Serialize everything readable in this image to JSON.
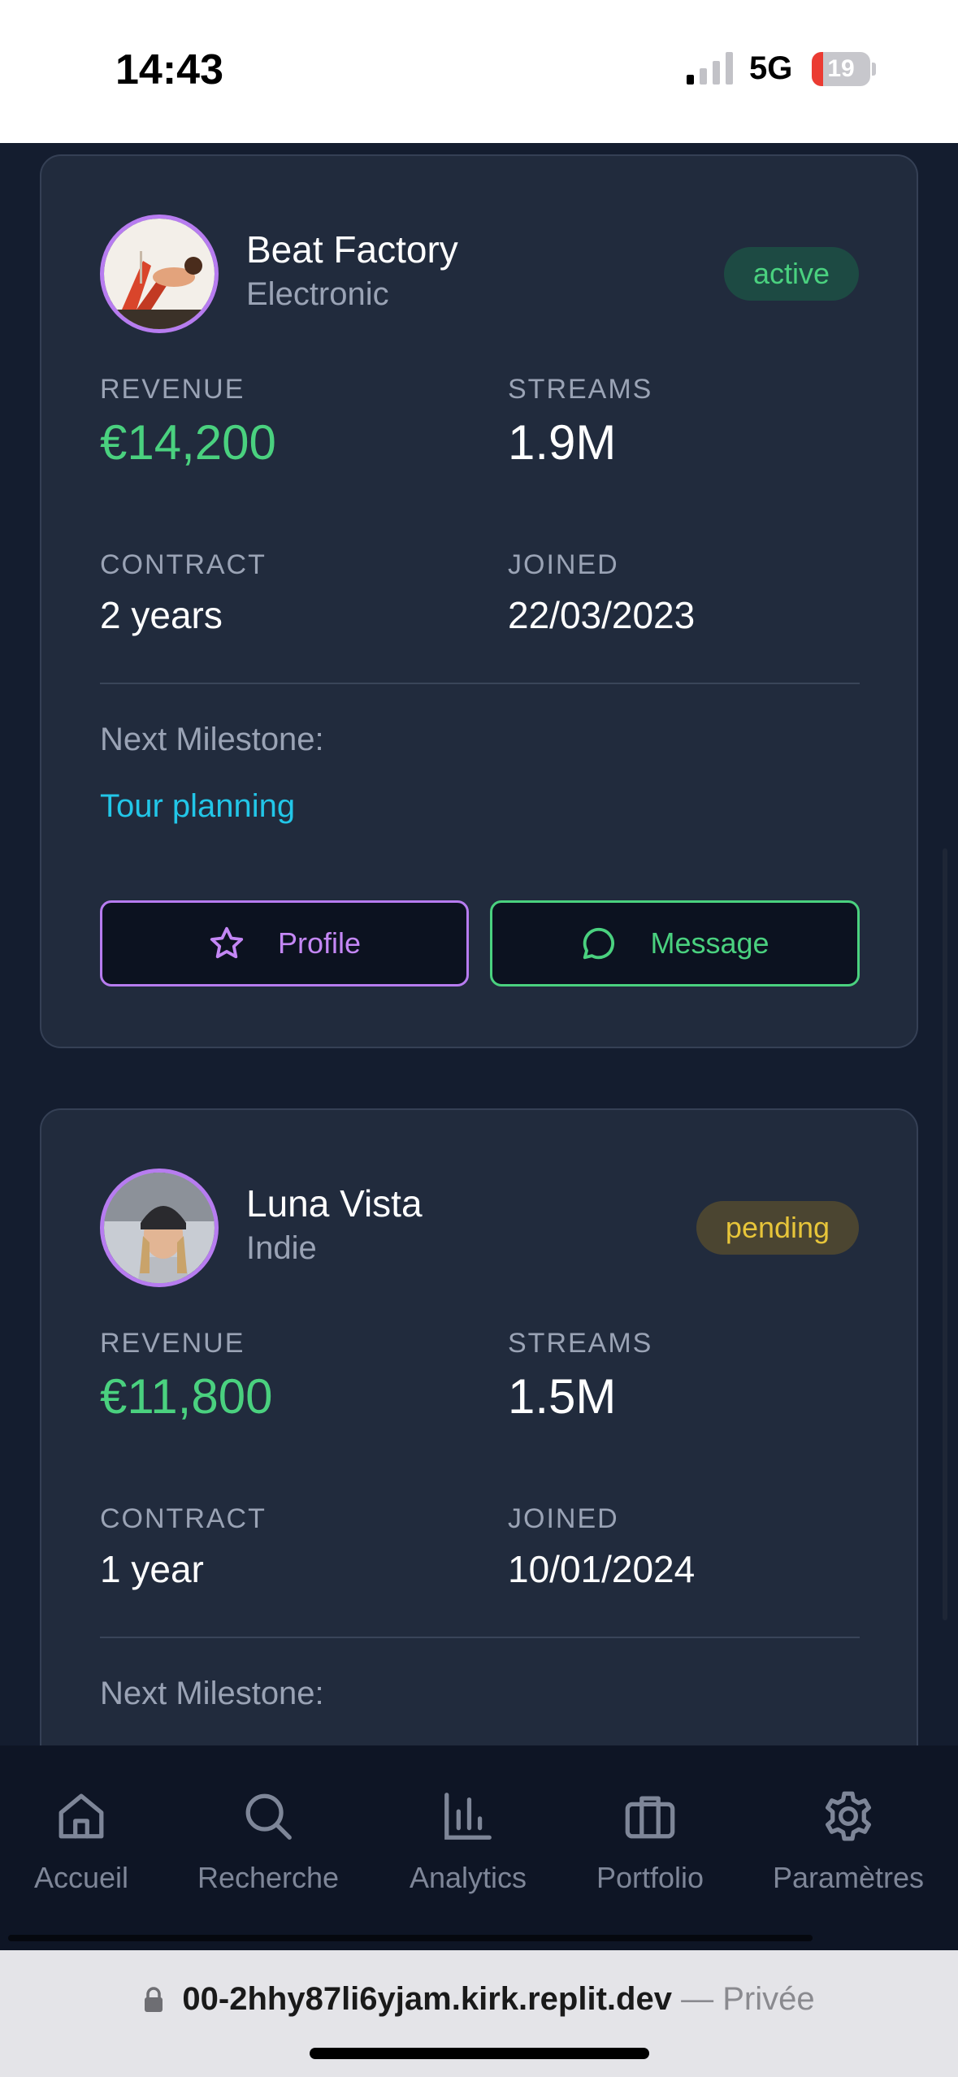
{
  "status_bar": {
    "time": "14:43",
    "network": "5G",
    "battery": "19",
    "battery_level_percent": 19
  },
  "artists": [
    {
      "name": "Beat Factory",
      "genre": "Electronic",
      "status": "active",
      "revenue_label": "REVENUE",
      "revenue": "€14,200",
      "streams_label": "STREAMS",
      "streams": "1.9M",
      "contract_label": "CONTRACT",
      "contract": "2 years",
      "joined_label": "JOINED",
      "joined": "22/03/2023",
      "milestone_label": "Next Milestone:",
      "milestone": "Tour planning",
      "profile_label": "Profile",
      "message_label": "Message"
    },
    {
      "name": "Luna Vista",
      "genre": "Indie",
      "status": "pending",
      "revenue_label": "REVENUE",
      "revenue": "€11,800",
      "streams_label": "STREAMS",
      "streams": "1.5M",
      "contract_label": "CONTRACT",
      "contract": "1 year",
      "joined_label": "JOINED",
      "joined": "10/01/2024",
      "milestone_label": "Next Milestone:"
    }
  ],
  "nav": [
    {
      "label": "Accueil",
      "icon": "home-icon"
    },
    {
      "label": "Recherche",
      "icon": "search-icon"
    },
    {
      "label": "Analytics",
      "icon": "bar-chart-icon"
    },
    {
      "label": "Portfolio",
      "icon": "briefcase-icon"
    },
    {
      "label": "Paramètres",
      "icon": "gear-icon"
    }
  ],
  "url_bar": {
    "url": "00-2hhy87li6yjam.kirk.replit.dev",
    "privacy": "— Privée"
  },
  "colors": {
    "accent_purple": "#b77cf0",
    "accent_green": "#4ad17f",
    "milestone_cyan": "#22c6e8",
    "pending_yellow": "#e7c53a"
  }
}
